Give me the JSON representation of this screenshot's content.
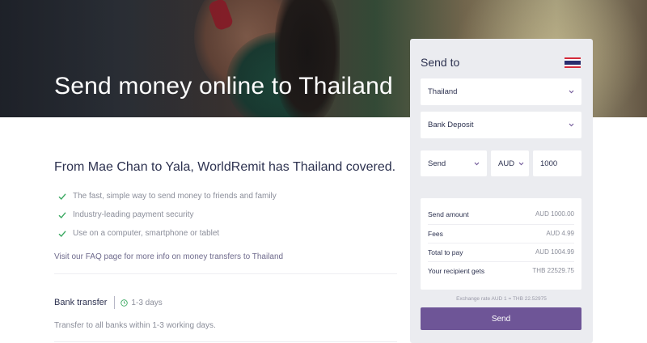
{
  "hero": {
    "title": "Send money online to Thailand"
  },
  "main": {
    "headline": "From Mae Chan to Yala, WorldRemit has Thailand covered.",
    "features": [
      "The fast, simple way to send money to friends and family",
      "Industry-leading payment security",
      "Use on a computer, smartphone or tablet"
    ],
    "faq_link": "Visit our FAQ page for more info on money transfers to Thailand",
    "transfer": {
      "title": "Bank transfer",
      "time": "1-3 days",
      "description": "Transfer to all banks within 1-3 working days."
    }
  },
  "panel": {
    "title": "Send to",
    "flag_icon": "thailand-flag-icon",
    "country": "Thailand",
    "method": "Bank Deposit",
    "send_type": "Send",
    "currency": "AUD",
    "amount": "1000",
    "summary": [
      {
        "label": "Send amount",
        "value": "AUD 1000.00"
      },
      {
        "label": "Fees",
        "value": "AUD 4.99"
      },
      {
        "label": "Total to pay",
        "value": "AUD 1004.99"
      },
      {
        "label": "Your recipient gets",
        "value": "THB 22529.75"
      }
    ],
    "exchange_rate": "Exchange rate AUD 1 = THB 22.52975",
    "send_button": "Send"
  },
  "colors": {
    "accent": "#6e5597",
    "check": "#3aa860",
    "text_dark": "#2d3250",
    "panel_bg": "#ebecf0"
  }
}
